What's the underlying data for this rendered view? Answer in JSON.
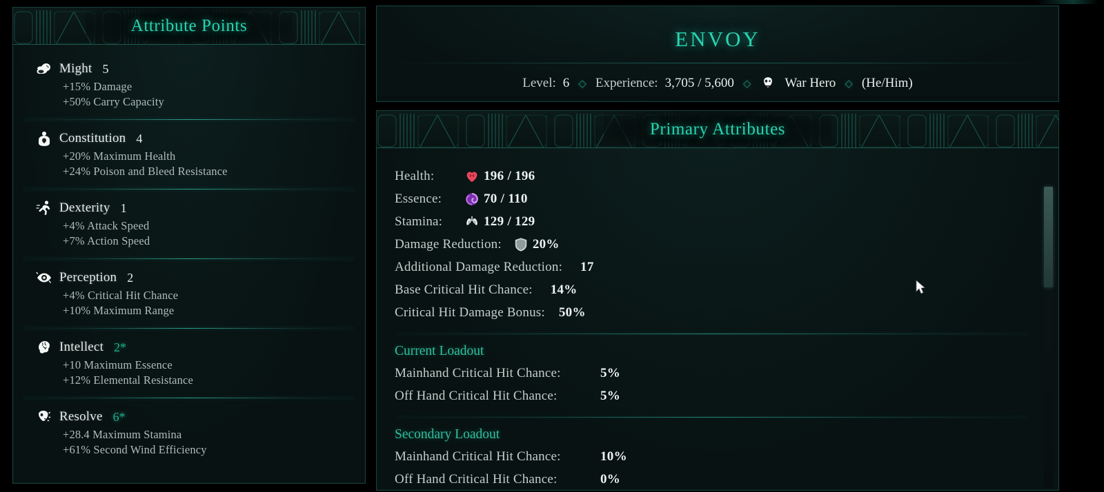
{
  "colors": {
    "accent_teal": "#2ad3b0",
    "sub_head_teal": "#2fbf9f",
    "buffed_value": "#1fae8d",
    "body_text": "#c6d1ce",
    "value_text": "#eef4f2",
    "panel_border": "#15413c",
    "background": "#000000",
    "health_icon": "#e8465c",
    "essence_icon": "#a23fd6",
    "stamina_icon": "#dfe6e4",
    "shield_icon": "#cfd8d6"
  },
  "left_panel": {
    "title": "Attribute Points",
    "attributes": [
      {
        "icon": "bicep-icon",
        "name": "Might",
        "value": "5",
        "buffed": false,
        "bonuses": [
          "+15% Damage",
          "+50% Carry Capacity"
        ]
      },
      {
        "icon": "torso-icon",
        "name": "Constitution",
        "value": "4",
        "buffed": false,
        "bonuses": [
          "+20% Maximum Health",
          "+24% Poison and Bleed Resistance"
        ]
      },
      {
        "icon": "runner-icon",
        "name": "Dexterity",
        "value": "1",
        "buffed": false,
        "bonuses": [
          "+4% Attack Speed",
          "+7% Action Speed"
        ]
      },
      {
        "icon": "eye-icon",
        "name": "Perception",
        "value": "2",
        "buffed": false,
        "bonuses": [
          "+4% Critical Hit Chance",
          "+10% Maximum Range"
        ]
      },
      {
        "icon": "brain-icon",
        "name": "Intellect",
        "value": "2*",
        "buffed": true,
        "bonuses": [
          "+10 Maximum Essence",
          "+12% Elemental Resistance"
        ]
      },
      {
        "icon": "mask-resolve-icon",
        "name": "Resolve",
        "value": "6*",
        "buffed": true,
        "bonuses": [
          "+28.4 Maximum Stamina",
          "+61% Second Wind Efficiency"
        ]
      }
    ]
  },
  "character_header": {
    "name": "ENVOY",
    "level_label": "Level:",
    "level_value": "6",
    "experience_label": "Experience:",
    "experience_value": "3,705 / 5,600",
    "title_icon": "war-hero-mask-icon",
    "title_text": "War Hero",
    "pronouns": "(He/Him)",
    "separator": "◇"
  },
  "primary_attributes": {
    "title": "Primary Attributes",
    "vitals": [
      {
        "label": "Health:",
        "icon": "heart-icon",
        "value": "196 / 196"
      },
      {
        "label": "Essence:",
        "icon": "essence-spiral-icon",
        "value": "70 / 110"
      },
      {
        "label": "Stamina:",
        "icon": "lungs-icon",
        "value": "129 / 129"
      }
    ],
    "combat_stats": [
      {
        "label": "Damage Reduction:",
        "icon": "shield-icon",
        "value": "20%"
      },
      {
        "label": "Additional Damage Reduction:",
        "icon": null,
        "value": "17"
      },
      {
        "label": "Base Critical Hit Chance:",
        "icon": null,
        "value": "14%"
      },
      {
        "label": "Critical Hit Damage Bonus:",
        "icon": null,
        "value": "50%"
      }
    ],
    "loadouts": [
      {
        "heading": "Current Loadout",
        "stats": [
          {
            "label": "Mainhand Critical Hit Chance:",
            "value": "5%"
          },
          {
            "label": "Off Hand Critical Hit Chance:",
            "value": "5%"
          }
        ]
      },
      {
        "heading": "Secondary Loadout",
        "stats": [
          {
            "label": "Mainhand Critical Hit Chance:",
            "value": "10%"
          },
          {
            "label": "Off Hand Critical Hit Chance:",
            "value": "0%"
          }
        ]
      }
    ]
  }
}
